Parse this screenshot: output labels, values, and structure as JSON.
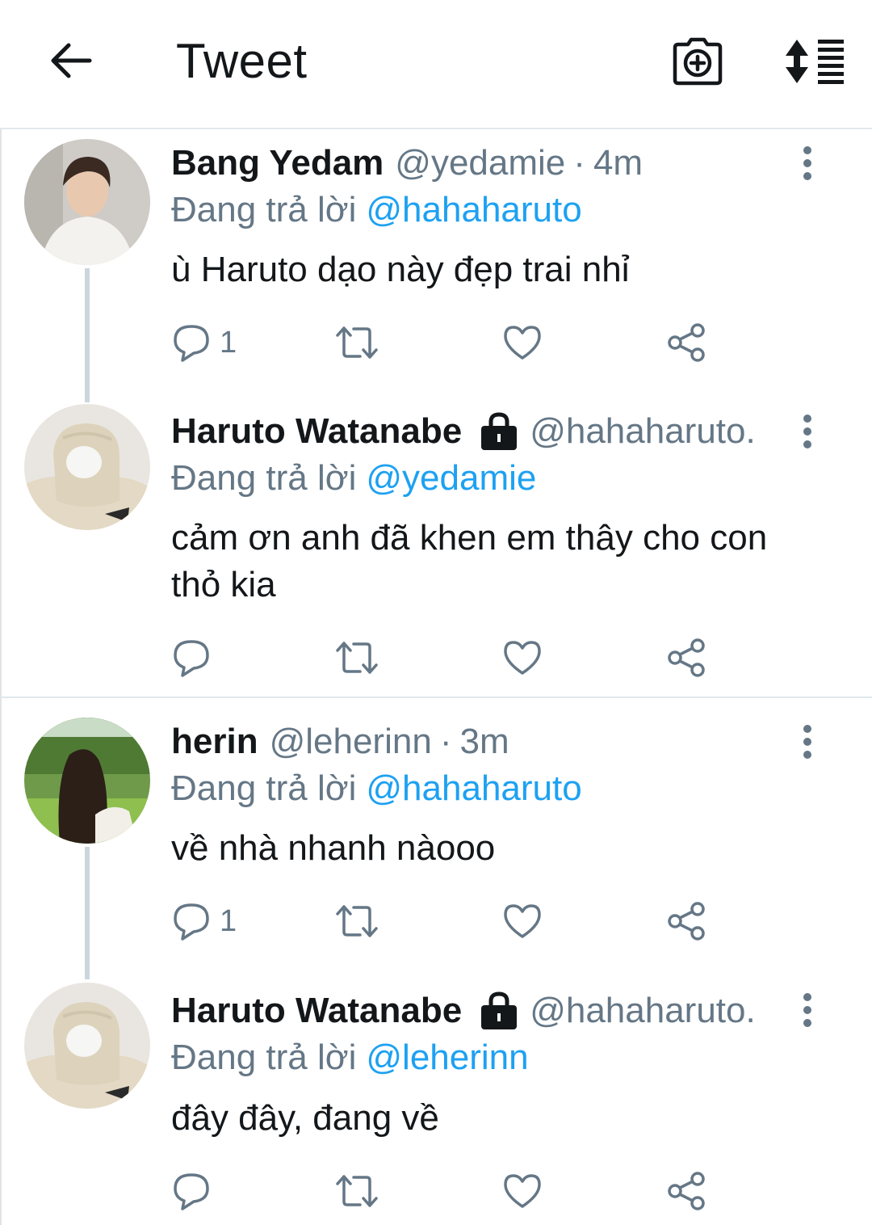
{
  "header": {
    "title": "Tweet",
    "back_icon": "arrow-left-icon",
    "camera_icon": "camera-plus-icon",
    "sort_icon": "sort-icon"
  },
  "colors": {
    "text": "#14171a",
    "secondary": "#657786",
    "link": "#1da1f2",
    "divider": "#e1e8ed",
    "thread_line": "#ccd6dd"
  },
  "tweets": [
    {
      "name": "Bang Yedam",
      "handle": "@yedamie",
      "sep": "·",
      "time": "4m",
      "locked": false,
      "reply_prefix": "Đang trả lời",
      "reply_to": "@hahaharuto",
      "text": "ù Haruto dạo này đẹp trai nhỉ",
      "reply_count": "1"
    },
    {
      "name": "Haruto Watanabe",
      "handle": "@hahaharuto.",
      "sep": "",
      "time": "",
      "locked": true,
      "reply_prefix": "Đang trả lời",
      "reply_to": "@yedamie",
      "text": "cảm ơn anh đã khen em thây cho con thỏ kia",
      "reply_count": ""
    },
    {
      "name": "herin",
      "handle": "@leherinn",
      "sep": "·",
      "time": "3m",
      "locked": false,
      "reply_prefix": "Đang trả lời",
      "reply_to": "@hahaharuto",
      "text": "về nhà nhanh nàooo",
      "reply_count": "1"
    },
    {
      "name": "Haruto Watanabe",
      "handle": "@hahaharuto.",
      "sep": "",
      "time": "",
      "locked": true,
      "reply_prefix": "Đang trả lời",
      "reply_to": "@leherinn",
      "text": "đây đây, đang về",
      "reply_count": ""
    }
  ]
}
